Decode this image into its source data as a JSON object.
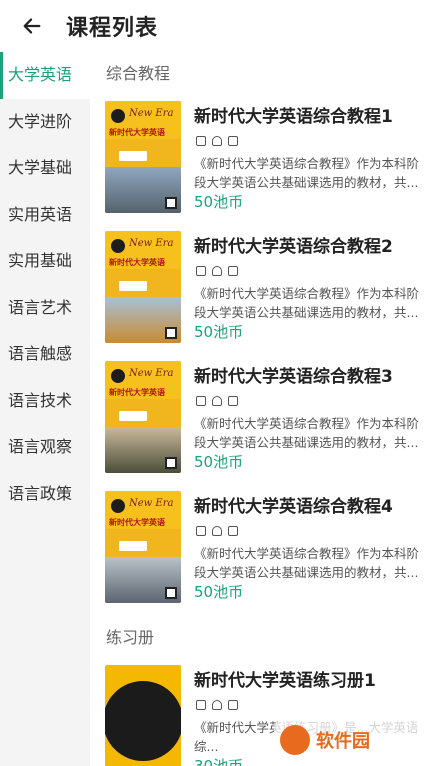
{
  "header": {
    "title": "课程列表"
  },
  "sidebar": {
    "items": [
      {
        "label": "大学英语",
        "active": true
      },
      {
        "label": "大学进阶"
      },
      {
        "label": "大学基础"
      },
      {
        "label": "实用英语"
      },
      {
        "label": "实用基础"
      },
      {
        "label": "语言艺术"
      },
      {
        "label": "语言触感"
      },
      {
        "label": "语言技术"
      },
      {
        "label": "语言观察"
      },
      {
        "label": "语言政策"
      }
    ]
  },
  "sections": [
    {
      "title": "综合教程",
      "courses": [
        {
          "title": "新时代大学英语综合教程1",
          "desc": "《新时代大学英语综合教程》作为本科阶段大学英语公共基础课选用的教材，共...",
          "price": "50池币"
        },
        {
          "title": "新时代大学英语综合教程2",
          "desc": "《新时代大学英语综合教程》作为本科阶段大学英语公共基础课选用的教材，共...",
          "price": "50池币"
        },
        {
          "title": "新时代大学英语综合教程3",
          "desc": "《新时代大学英语综合教程》作为本科阶段大学英语公共基础课选用的教材，共...",
          "price": "50池币"
        },
        {
          "title": "新时代大学英语综合教程4",
          "desc": "《新时代大学英语综合教程》作为本科阶段大学英语公共基础课选用的教材，共...",
          "price": "50池币"
        }
      ]
    },
    {
      "title": "练习册",
      "courses": [
        {
          "title": "新时代大学英语练习册1",
          "desc": "《新时代大学英语练习册》是...大学英语综...",
          "price": "30池币"
        }
      ]
    }
  ],
  "cover": {
    "brand": "New Era",
    "cn_title": "新时代大学英语"
  },
  "watermark": {
    "text": "软件园"
  },
  "colors": {
    "accent": "#1aa37a",
    "sidebar_bg": "#f4f4f4"
  }
}
